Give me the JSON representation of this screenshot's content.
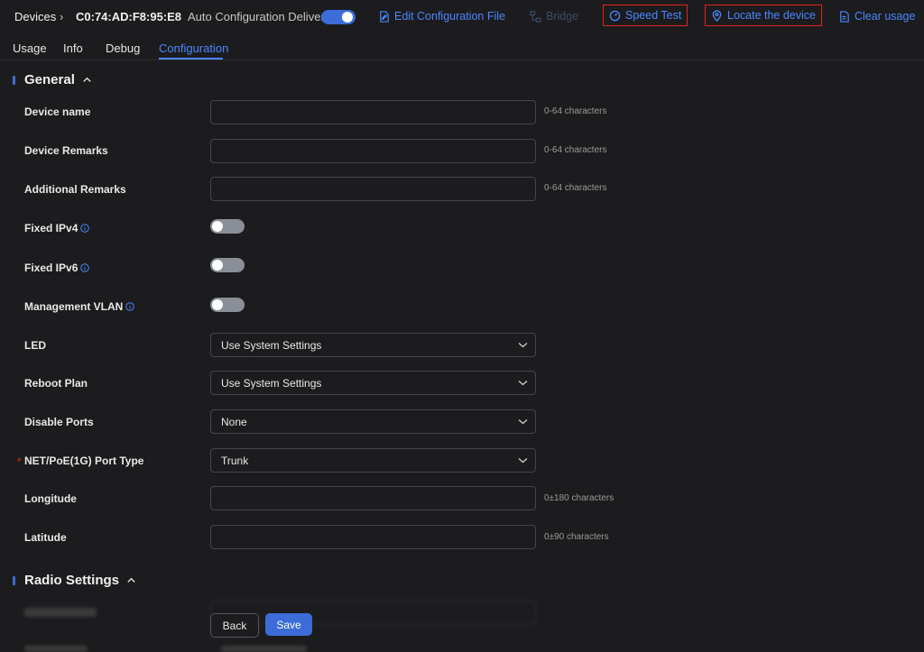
{
  "header": {
    "breadcrumb_root": "Devices",
    "device_mac": "C0:74:AD:F8:95:E8",
    "auto_config_label": "Auto Configuration Delivery",
    "auto_config_on": true,
    "actions": {
      "edit_config": "Edit Configuration File",
      "bridge": "Bridge",
      "speed_test": "Speed Test",
      "locate": "Locate the device",
      "clear_usage": "Clear usage"
    }
  },
  "tabs": [
    "Usage",
    "Info",
    "Debug",
    "Configuration"
  ],
  "active_tab": "Configuration",
  "general": {
    "title": "General",
    "fields": {
      "device_name": {
        "label": "Device name",
        "value": "",
        "hint": "0-64 characters"
      },
      "device_remarks": {
        "label": "Device Remarks",
        "value": "",
        "hint": "0-64 characters"
      },
      "additional_remarks": {
        "label": "Additional Remarks",
        "value": "",
        "hint": "0-64 characters"
      },
      "fixed_ipv4": {
        "label": "Fixed IPv4",
        "on": false
      },
      "fixed_ipv6": {
        "label": "Fixed IPv6",
        "on": false
      },
      "management_vlan": {
        "label": "Management VLAN",
        "on": false
      },
      "led": {
        "label": "LED",
        "value": "Use System Settings"
      },
      "reboot_plan": {
        "label": "Reboot Plan",
        "value": "Use System Settings"
      },
      "disable_ports": {
        "label": "Disable Ports",
        "value": "None"
      },
      "port_type": {
        "label": "NET/PoE(1G) Port Type",
        "value": "Trunk",
        "required_mark": "*"
      },
      "longitude": {
        "label": "Longitude",
        "value": "",
        "hint": "0±180 characters"
      },
      "latitude": {
        "label": "Latitude",
        "value": "",
        "hint": "0±90 characters"
      }
    }
  },
  "radio": {
    "title": "Radio Settings"
  },
  "footer": {
    "back_label": "Back",
    "save_label": "Save"
  },
  "colors": {
    "accent": "#3b6cd8",
    "link": "#4a86ff",
    "highlight_box": "#e0241b",
    "background": "#1c1c1e"
  }
}
